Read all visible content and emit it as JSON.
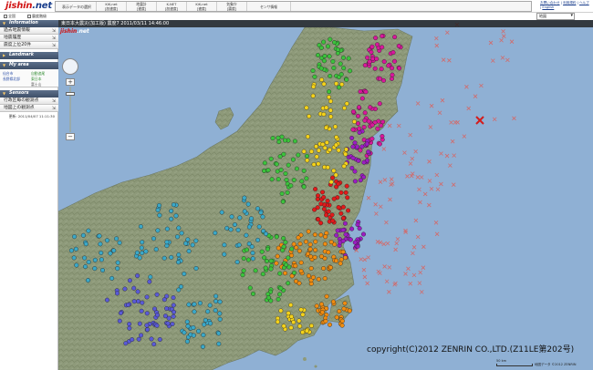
{
  "logo": {
    "text": "jishin",
    "suffix": ".net"
  },
  "toolbar": {
    "select_label": "表示データの選択",
    "networks": [
      {
        "line1": "KiK-net",
        "line2": "[加速度]"
      },
      {
        "line1": "地震計",
        "line2": "[速度]"
      },
      {
        "line1": "K-NET",
        "line2": "[加速度]"
      },
      {
        "line1": "KiK-net",
        "line2": "[速度]"
      },
      {
        "line1": "気象庁",
        "line2": "[震度]"
      }
    ],
    "sensor_label": "センサ情報"
  },
  "top_links": [
    "お問い合わせ",
    "利用規約",
    "ヘルプ",
    "English"
  ],
  "row2": {
    "check_all": "全国",
    "check_intensity": "震度階級",
    "map_type": "地図"
  },
  "sidebar": {
    "information_header": "Information",
    "information_items": [
      "過去地震情報",
      "地震履歴",
      "震度上位20件"
    ],
    "landmark_header": "Landmark",
    "myarea_header": "My area",
    "myarea_regions": [
      {
        "label": "仙台市",
        "color": "blue"
      },
      {
        "label": "長野県北部",
        "color": "blue"
      },
      {
        "label": "自動追尾",
        "color": "green"
      },
      {
        "label": "東日本",
        "color": "green"
      },
      {
        "label": "富士山",
        "color": "grey"
      }
    ],
    "sensors_header": "Sensors",
    "sensors_items": [
      "行政区毎の観測点",
      "地図上の観測点"
    ],
    "updated": "更新: 2011/04/07 11:11:30"
  },
  "map": {
    "title": "東日本大震災(加工版) 震度7 2011/03/11 14:46:00",
    "copyright": "copyright(C)2012 ZENRIN CO.,LTD.(Z11LE第202号)",
    "scale_label": "50 km",
    "attribution": "地図データ ©2012 ZENRIN"
  },
  "colors": {
    "sea": "#8fb0d4",
    "land": "#8d9a78",
    "title_bar": "#1e1e1e",
    "intensity_7": "#9c1dc2",
    "intensity_6": "#d8189b",
    "intensity_5": "#e21a1a",
    "intensity_4": "#f08c10",
    "intensity_3": "#f4d21a",
    "intensity_2": "#3cc23c",
    "intensity_1": "#3aa8c8",
    "intensity_0": "#5a5ad6",
    "epicenter": "#d41c1c",
    "aftershock": "#d26a6a"
  }
}
